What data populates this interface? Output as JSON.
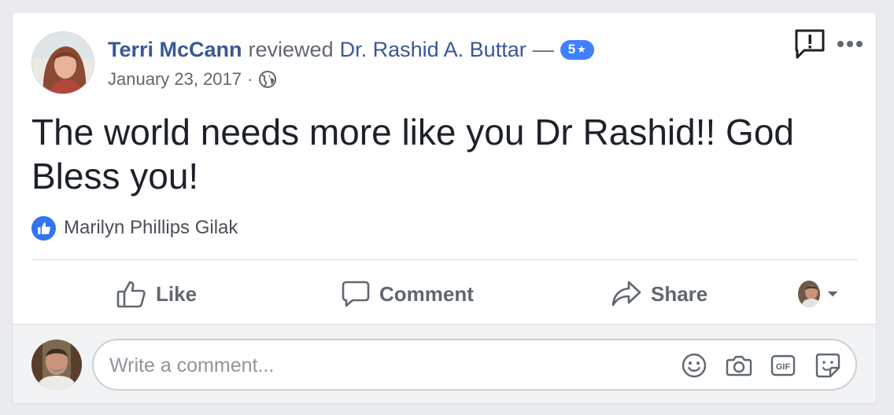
{
  "post": {
    "author": "Terri McCann",
    "verb": "reviewed",
    "subject": "Dr. Rashid A. Buttar",
    "dash": "—",
    "rating": "5",
    "rating_star": "★",
    "date": "January 23, 2017",
    "separator": "·",
    "privacy_icon": "globe-icon",
    "text": "The world needs more like you Dr Rashid!! God Bless you!"
  },
  "reactions": {
    "icon": "thumbs-up-icon",
    "likers": "Marilyn Phillips Gilak"
  },
  "actions": {
    "like_label": "Like",
    "comment_label": "Comment",
    "share_label": "Share"
  },
  "composer": {
    "placeholder": "Write a comment...",
    "value": "",
    "icons": [
      "emoji-icon",
      "camera-icon",
      "gif-icon",
      "sticker-icon"
    ]
  },
  "colors": {
    "link": "#385898",
    "badge": "#4080ff",
    "like_bubble": "#2f74f1",
    "background": "#e9ebee"
  }
}
